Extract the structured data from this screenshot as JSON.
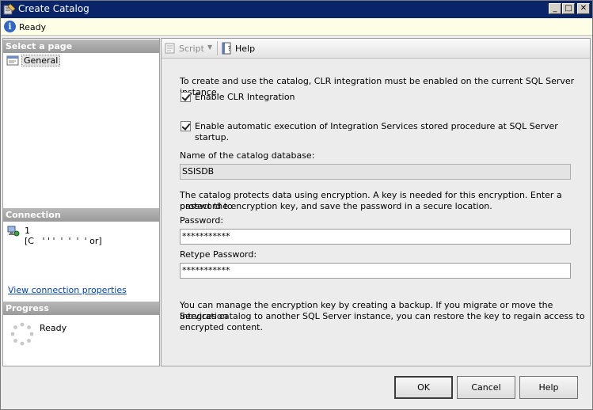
{
  "window": {
    "title": "Create Catalog",
    "controls": {
      "minimize": "_",
      "maximize": "□",
      "close": "✕"
    }
  },
  "status_strip": {
    "text": "Ready"
  },
  "left_panel": {
    "select_page_header": "Select a page",
    "pages": [
      {
        "label": "General",
        "icon": "page-properties-icon"
      }
    ],
    "connection_header": "Connection",
    "connection_line1": "1",
    "connection_line2": "[C   ' ' '  '  '  '  ' or]",
    "connection_link": "View connection properties",
    "progress_header": "Progress",
    "progress_status": "Ready"
  },
  "toolbar": {
    "script_label": "Script",
    "help_label": "Help"
  },
  "form": {
    "intro": "To create and use the catalog, CLR integration must be enabled on the current SQL Server instance.",
    "enable_clr_label": "Enable CLR Integration",
    "enable_clr_checked": true,
    "enable_auto_label": "Enable automatic execution of Integration Services stored procedure at SQL Server startup.",
    "enable_auto_checked": true,
    "catalog_db_label": "Name of the catalog database:",
    "catalog_db_value": "SSISDB",
    "encryption_line1": "The catalog protects data using encryption. A key is needed for this encryption. Enter a password to",
    "encryption_line2": "protect the encryption key, and save the password in a secure location.",
    "password_label": "Password:",
    "password_value": "***********",
    "retype_label": "Retype Password:",
    "retype_value": "***********",
    "backup_line1": "You can manage the encryption key by creating a backup. If you migrate or move the Integration",
    "backup_line2": "Services catalog to another SQL Server instance, you can restore the key to regain access to",
    "backup_line3": "encrypted content."
  },
  "buttons": {
    "ok": "OK",
    "cancel": "Cancel",
    "help": "Help"
  },
  "colors": {
    "titlebar": "#0a246a",
    "status_strip": "#fefee6",
    "link": "#0645ad"
  }
}
